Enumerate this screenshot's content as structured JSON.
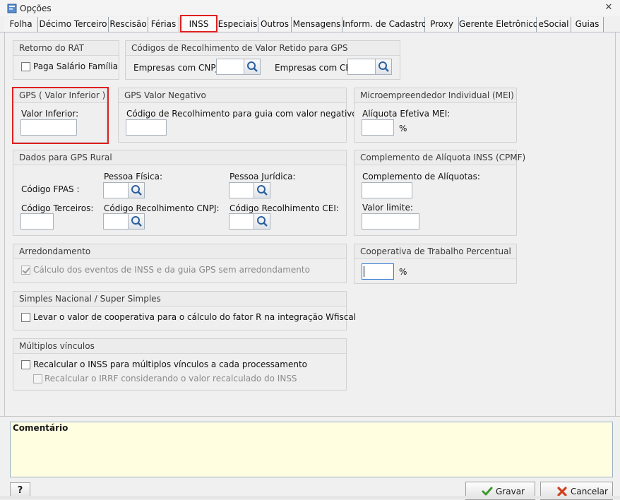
{
  "window": {
    "title": "Opções",
    "close_glyph": "✕"
  },
  "tabs": [
    {
      "label": "Folha"
    },
    {
      "label": "Décimo Terceiro"
    },
    {
      "label": "Rescisão"
    },
    {
      "label": "Férias"
    },
    {
      "label": "INSS"
    },
    {
      "label": "Especiais"
    },
    {
      "label": "Outros"
    },
    {
      "label": "Mensagens"
    },
    {
      "label": "Inform. de Cadastro"
    },
    {
      "label": "Proxy"
    },
    {
      "label": "Gerente Eletrônico"
    },
    {
      "label": "eSocial"
    },
    {
      "label": "Guias"
    }
  ],
  "active_tab": "INSS",
  "rat": {
    "legend": "Retorno do RAT",
    "paga_salario_familia": "Paga Salário Família"
  },
  "codigos": {
    "legend": "Códigos de Recolhimento de Valor Retido para GPS",
    "cnpj_label": "Empresas com CNPJ:",
    "cnpj_value": "",
    "cei_label": "Empresas com CEI:",
    "cei_value": ""
  },
  "gps_inferior": {
    "legend": "GPS ( Valor Inferior )",
    "label": "Valor Inferior:",
    "value": ""
  },
  "gps_negativo": {
    "legend": "GPS Valor Negativo",
    "label": "Código de Recolhimento para guia com valor negativo:",
    "value": ""
  },
  "mei": {
    "legend": "Microempreendedor Individual (MEI)",
    "label": "Alíquota Efetiva MEI:",
    "value": "",
    "unit": "%"
  },
  "gps_rural": {
    "legend": "Dados para GPS Rural",
    "pessoa_fisica": "Pessoa Física:",
    "pessoa_juridica": "Pessoa Jurídica:",
    "codigo_fpas": "Código FPAS :",
    "codigo_terceiros": "Código Terceiros:",
    "codigo_recolhimento_cnpj": "Código Recolhimento CNPJ:",
    "codigo_recolhimento_cei": "Código Recolhimento CEI:"
  },
  "cpmf": {
    "legend": "Complemento de Alíquota INSS (CPMF)",
    "complemento_label": "Complemento de Alíquotas:",
    "valor_limite_label": "Valor limite:"
  },
  "arredondamento": {
    "legend": "Arredondamento",
    "option": "Cálculo dos eventos de INSS e da guia GPS sem arredondamento"
  },
  "cooperativa": {
    "legend": "Cooperativa de Trabalho Percentual",
    "value": "",
    "unit": "%"
  },
  "simples": {
    "legend": "Simples Nacional / Super Simples",
    "option": "Levar o valor de cooperativa para o cálculo do fator R na integração Wfiscal"
  },
  "multiplos": {
    "legend": "Múltiplos vínculos",
    "option1": "Recalcular o INSS para múltiplos vínculos a cada processamento",
    "option2": "Recalcular o IRRF considerando o valor recalculado do INSS"
  },
  "comment": {
    "title": "Comentário"
  },
  "buttons": {
    "help": "?",
    "save": "Gravar",
    "cancel": "Cancelar"
  },
  "icons": [
    "app-icon",
    "close-icon",
    "search-icon",
    "check-icon",
    "cancel-icon"
  ],
  "colors": {
    "highlight": "#e02020",
    "comment_bg": "#fffee0"
  }
}
